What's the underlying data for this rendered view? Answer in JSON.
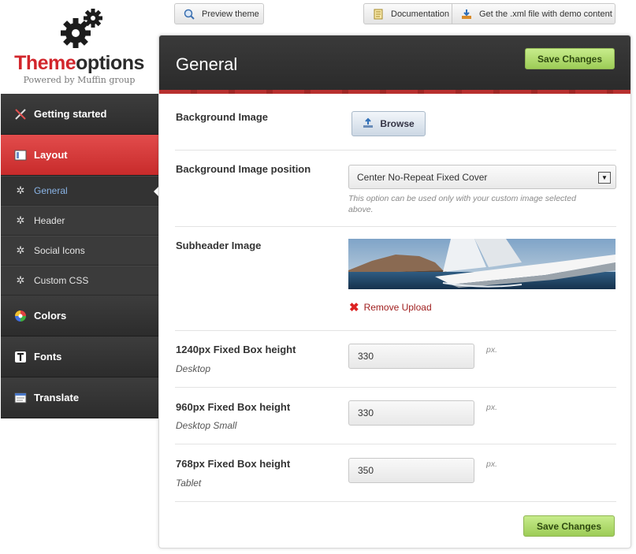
{
  "logo": {
    "title_red": "Theme",
    "title_dark": "options",
    "subtitle": "Powered by Muffin group"
  },
  "toolbar": {
    "preview_label": "Preview theme",
    "documentation_label": "Documentation",
    "xml_label": "Get the .xml file with demo content"
  },
  "sidebar": {
    "items": [
      {
        "label": "Getting started",
        "icon": "tools-icon"
      },
      {
        "label": "Layout",
        "icon": "layout-icon"
      },
      {
        "label": "General",
        "icon": "gear-icon"
      },
      {
        "label": "Header",
        "icon": "gear-icon"
      },
      {
        "label": "Social Icons",
        "icon": "gear-icon"
      },
      {
        "label": "Custom CSS",
        "icon": "gear-icon"
      },
      {
        "label": "Colors",
        "icon": "color-wheel-icon"
      },
      {
        "label": "Fonts",
        "icon": "font-icon"
      },
      {
        "label": "Translate",
        "icon": "translate-icon"
      }
    ]
  },
  "panel": {
    "title": "General",
    "save_label": "Save Changes",
    "background_image": {
      "label": "Background Image",
      "browse_label": "Browse"
    },
    "background_position": {
      "label": "Background Image position",
      "selected": "Center No-Repeat Fixed Cover",
      "hint": "This option can be used only with your custom image selected above."
    },
    "subheader_image": {
      "label": "Subheader Image",
      "remove_label": "Remove Upload"
    },
    "box_1240": {
      "label": "1240px Fixed Box height",
      "sub": "Desktop",
      "value": "330",
      "unit": "px."
    },
    "box_960": {
      "label": "960px Fixed Box height",
      "sub": "Desktop Small",
      "value": "330",
      "unit": "px."
    },
    "box_768": {
      "label": "768px Fixed Box height",
      "sub": "Tablet",
      "value": "350",
      "unit": "px."
    }
  },
  "colors": {
    "accent_red": "#d2262c",
    "save_green": "#9dcc57",
    "sidebar_dark": "#2e2e2e"
  }
}
